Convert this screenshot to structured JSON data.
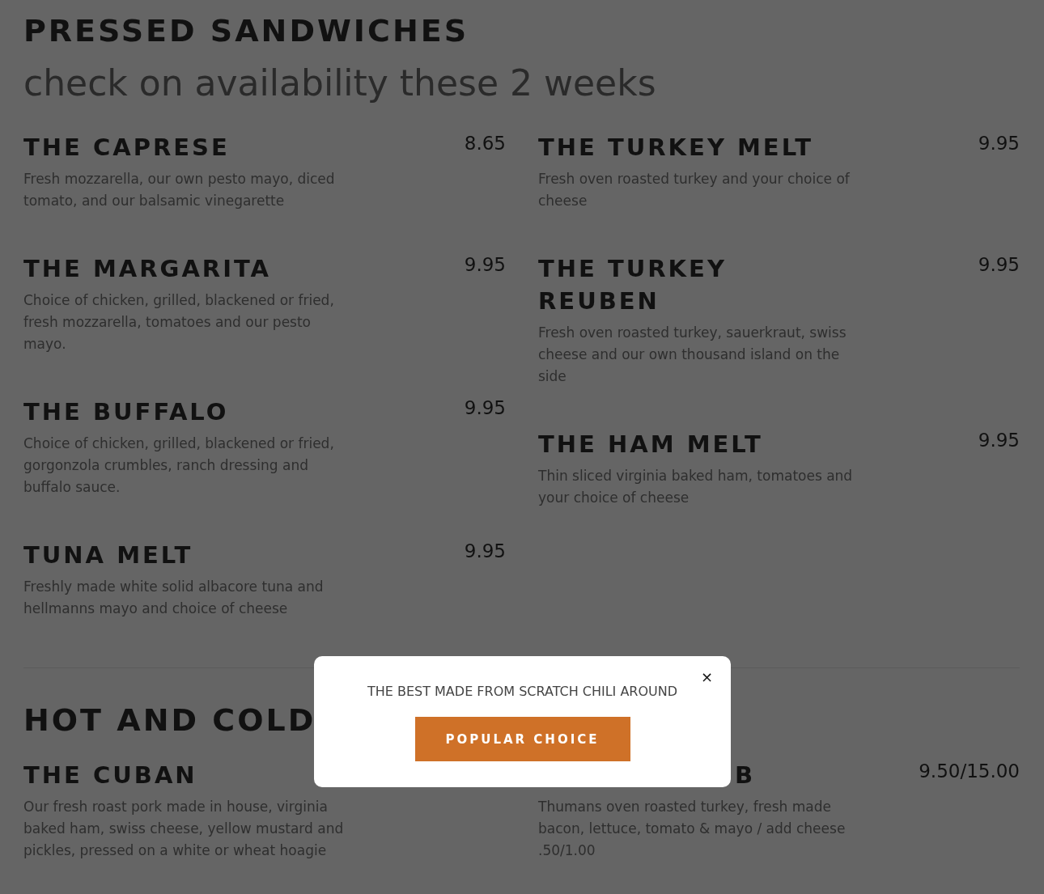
{
  "sections": [
    {
      "title": "PRESSED SANDWICHES",
      "subtitle": "check on availability these 2 weeks",
      "columns": [
        [
          {
            "name": "THE CAPRESE",
            "price": "8.65",
            "description": "Fresh mozzarella, our own pesto mayo, diced tomato, and our balsamic vinegarette"
          },
          {
            "name": "THE MARGARITA",
            "price": "9.95",
            "description": "Choice of chicken, grilled, blackened or fried, fresh mozzarella, tomatoes and our pesto mayo."
          },
          {
            "name": "THE BUFFALO",
            "price": "9.95",
            "description": "Choice of chicken, grilled, blackened or fried, gorgonzola crumbles, ranch dressing and buffalo sauce."
          },
          {
            "name": "TUNA MELT",
            "price": "9.95",
            "description": "Freshly made white solid albacore tuna and hellmanns mayo and choice of cheese"
          }
        ],
        [
          {
            "name": "THE TURKEY MELT",
            "price": "9.95",
            "description": "Fresh oven roasted turkey and your choice of cheese"
          },
          {
            "name": "THE TURKEY REUBEN",
            "price": "9.95",
            "description": "Fresh oven roasted turkey, sauerkraut, swiss cheese and our own thousand island on the side"
          },
          {
            "name": "THE HAM MELT",
            "price": "9.95",
            "description": "Thin sliced virginia baked ham, tomatoes and your choice of cheese"
          }
        ]
      ]
    },
    {
      "title": "HOT AND COLD",
      "columns": [
        [
          {
            "name": "THE CUBAN",
            "description": "Our fresh roast pork made in house, virginia baked ham, swiss cheese, yellow mustard and pickles, pressed on a white or wheat hoagie"
          }
        ],
        [
          {
            "name": "B",
            "kind": "covered",
            "price": "9.50/15.00",
            "description": "Thumans oven roasted turkey, fresh made bacon, lettuce, tomato & mayo / add cheese .50/1.00"
          }
        ]
      ]
    }
  ],
  "modal": {
    "text": "THE BEST MADE FROM SCRATCH CHILI AROUND",
    "close": "×",
    "button": "POPULAR CHOICE"
  }
}
